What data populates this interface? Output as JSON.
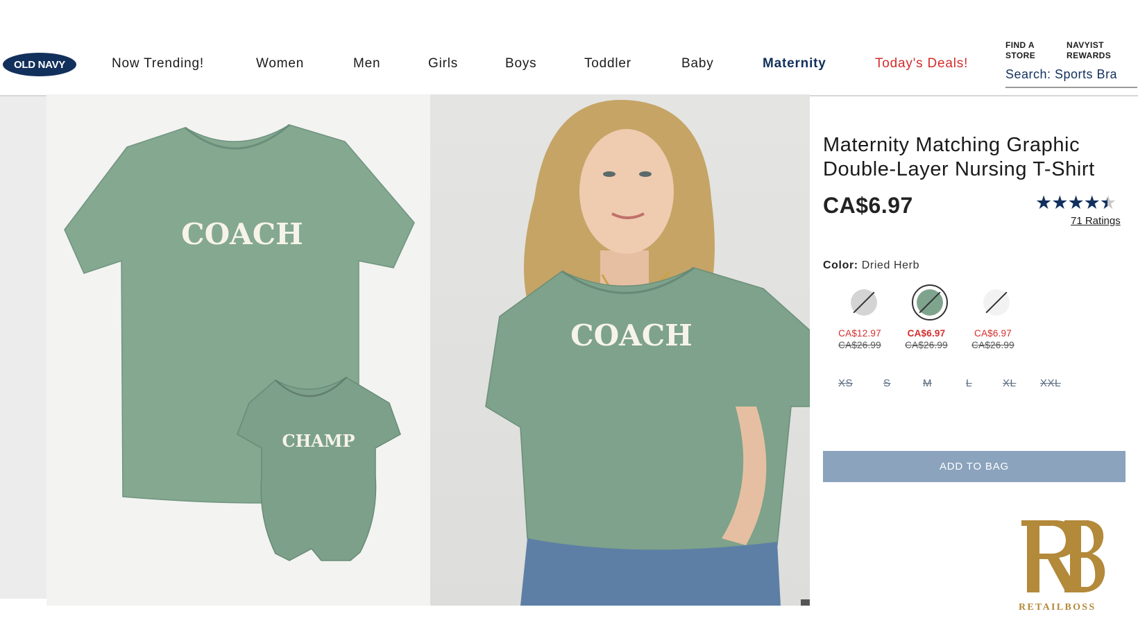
{
  "header": {
    "logo_text": "OLD NAVY",
    "nav": [
      {
        "label": "Now Trending!"
      },
      {
        "label": "Women"
      },
      {
        "label": "Men"
      },
      {
        "label": "Girls"
      },
      {
        "label": "Boys"
      },
      {
        "label": "Toddler"
      },
      {
        "label": "Baby"
      },
      {
        "label": "Maternity"
      },
      {
        "label": "Today's Deals!"
      }
    ],
    "find_store": [
      "FIND A",
      "STORE"
    ],
    "navyist_rewards": [
      "NAVYIST",
      "REWARDS"
    ],
    "search_text": "Search: Sports Bra"
  },
  "gallery": {
    "left_image": {
      "shirt_text": "COACH",
      "bodysuit_text": "CHAMP"
    },
    "right_image": {
      "shirt_text": "COACH"
    }
  },
  "product": {
    "title_line1": "Maternity Matching Graphic",
    "title_line2": "Double-Layer Nursing T-Shirt",
    "price": "CA$6.97",
    "rating_stars": 4.5,
    "ratings_link": "71 Ratings",
    "color_label": "Color:",
    "color_value": "Dried Herb",
    "swatches": [
      {
        "sale": "CA$12.97",
        "original": "CA$26.99",
        "color": "#d4d4d4",
        "selected": false
      },
      {
        "sale": "CA$6.97",
        "original": "CA$26.99",
        "color": "#7fa48d",
        "selected": true
      },
      {
        "sale": "CA$6.97",
        "original": "CA$26.99",
        "color": "#f2f2f2",
        "selected": false
      }
    ],
    "sizes": [
      "XS",
      "S",
      "M",
      "L",
      "XL",
      "XXL"
    ],
    "add_to_bag": "ADD TO BAG"
  },
  "watermark": {
    "text": "RETAILBOSS"
  },
  "colors": {
    "navy": "#12305c",
    "deal_red": "#d52b2b",
    "button_blue": "#8ba3bd",
    "tshirt_green": "#84a890",
    "watermark_gold": "#b3893a"
  }
}
